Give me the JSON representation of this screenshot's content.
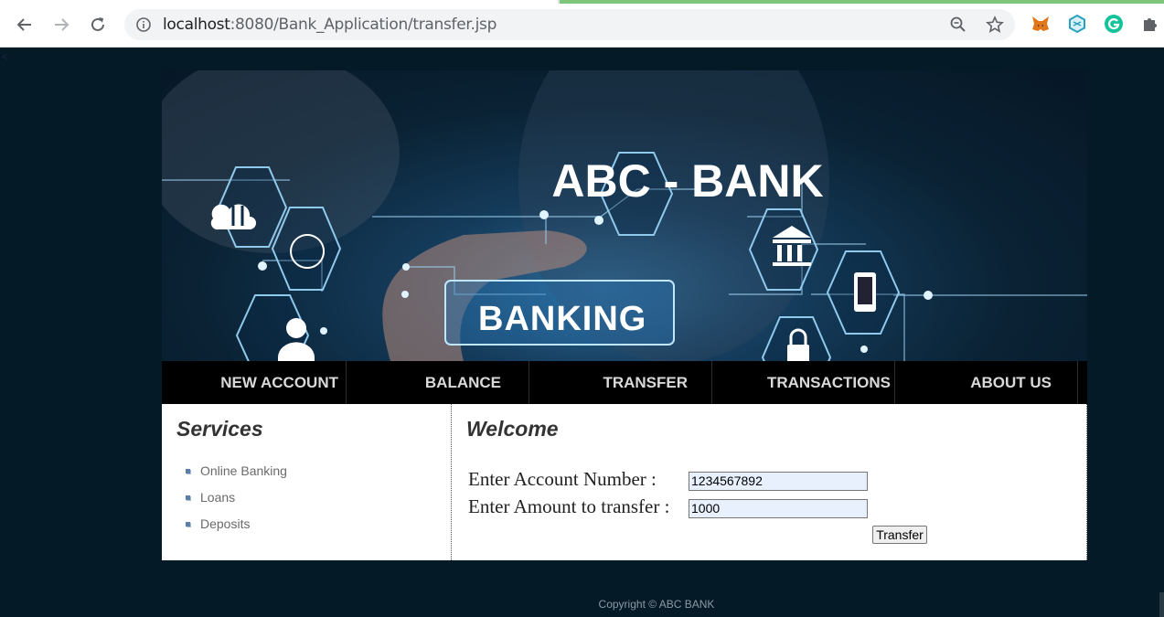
{
  "browser": {
    "url_host": "localhost",
    "url_path": ":8080/Bank_Application/transfer.jsp",
    "icons": [
      "back-arrow-icon",
      "forward-arrow-icon",
      "reload-icon",
      "info-icon",
      "zoom-icon",
      "star-icon",
      "metamask-icon",
      "extension-icon",
      "grammarly-icon",
      "puzzle-icon"
    ]
  },
  "banner": {
    "title": "ABC - BANK",
    "image_text": "BANKING"
  },
  "menu": {
    "items": [
      "NEW ACCOUNT",
      "BALANCE",
      "TRANSFER",
      "TRANSACTIONS",
      "ABOUT US"
    ]
  },
  "sidebar": {
    "heading": "Services",
    "items": [
      "Online Banking",
      "Loans",
      "Deposits"
    ]
  },
  "main": {
    "heading": "Welcome",
    "account_label": "Enter Account Number :",
    "account_value": "1234567892",
    "amount_label": "Enter Amount to transfer :",
    "amount_value": "1000",
    "submit_label": "Transfer"
  },
  "footer": {
    "copyright": "Copyright © ABC BANK"
  },
  "colors": {
    "page_bg": "#041a26",
    "menu_bg": "#000000",
    "menu_text": "#d9d9d9",
    "content_bg": "#ffffff"
  }
}
